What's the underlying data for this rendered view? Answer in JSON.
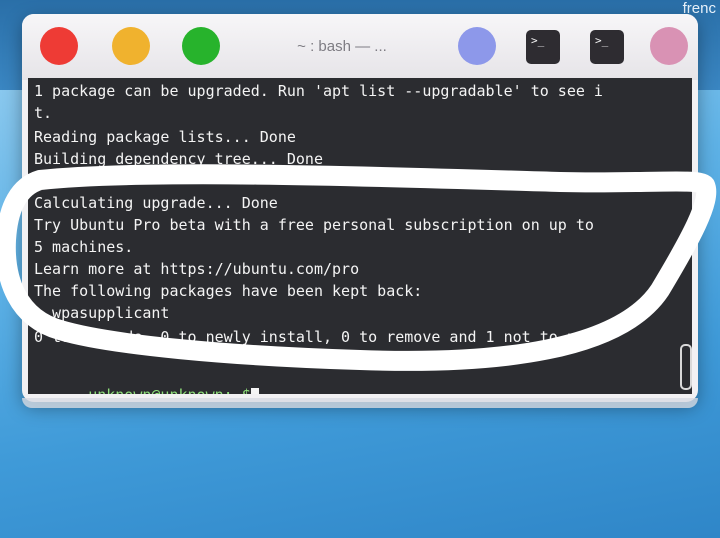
{
  "desktop": {
    "corner_text": "frenc"
  },
  "window": {
    "title": "~ : bash — ...",
    "tab_buttons": [
      ">_",
      ">_"
    ],
    "terminal": {
      "lines": [
        "1 package can be upgraded. Run 'apt list --upgradable' to see i",
        "t.",
        "Reading package lists... Done",
        "Building dependency tree... Done",
        "Calculating upgrade... Done",
        "Try Ubuntu Pro beta with a free personal subscription on up to",
        "5 machines.",
        "Learn more at https://ubuntu.com/pro",
        "The following packages have been kept back:",
        "  wpasupplicant",
        "0 to upgrade, 0 to newly install, 0 to remove and 1 not to upgr"
      ],
      "prompt": "unknown@unknown:~$"
    }
  },
  "colors": {
    "close": "#ee3b35",
    "minimize": "#f0b22e",
    "zoom": "#27b32c",
    "terminal_bg": "#2b2c30",
    "prompt": "#8fe07a"
  }
}
